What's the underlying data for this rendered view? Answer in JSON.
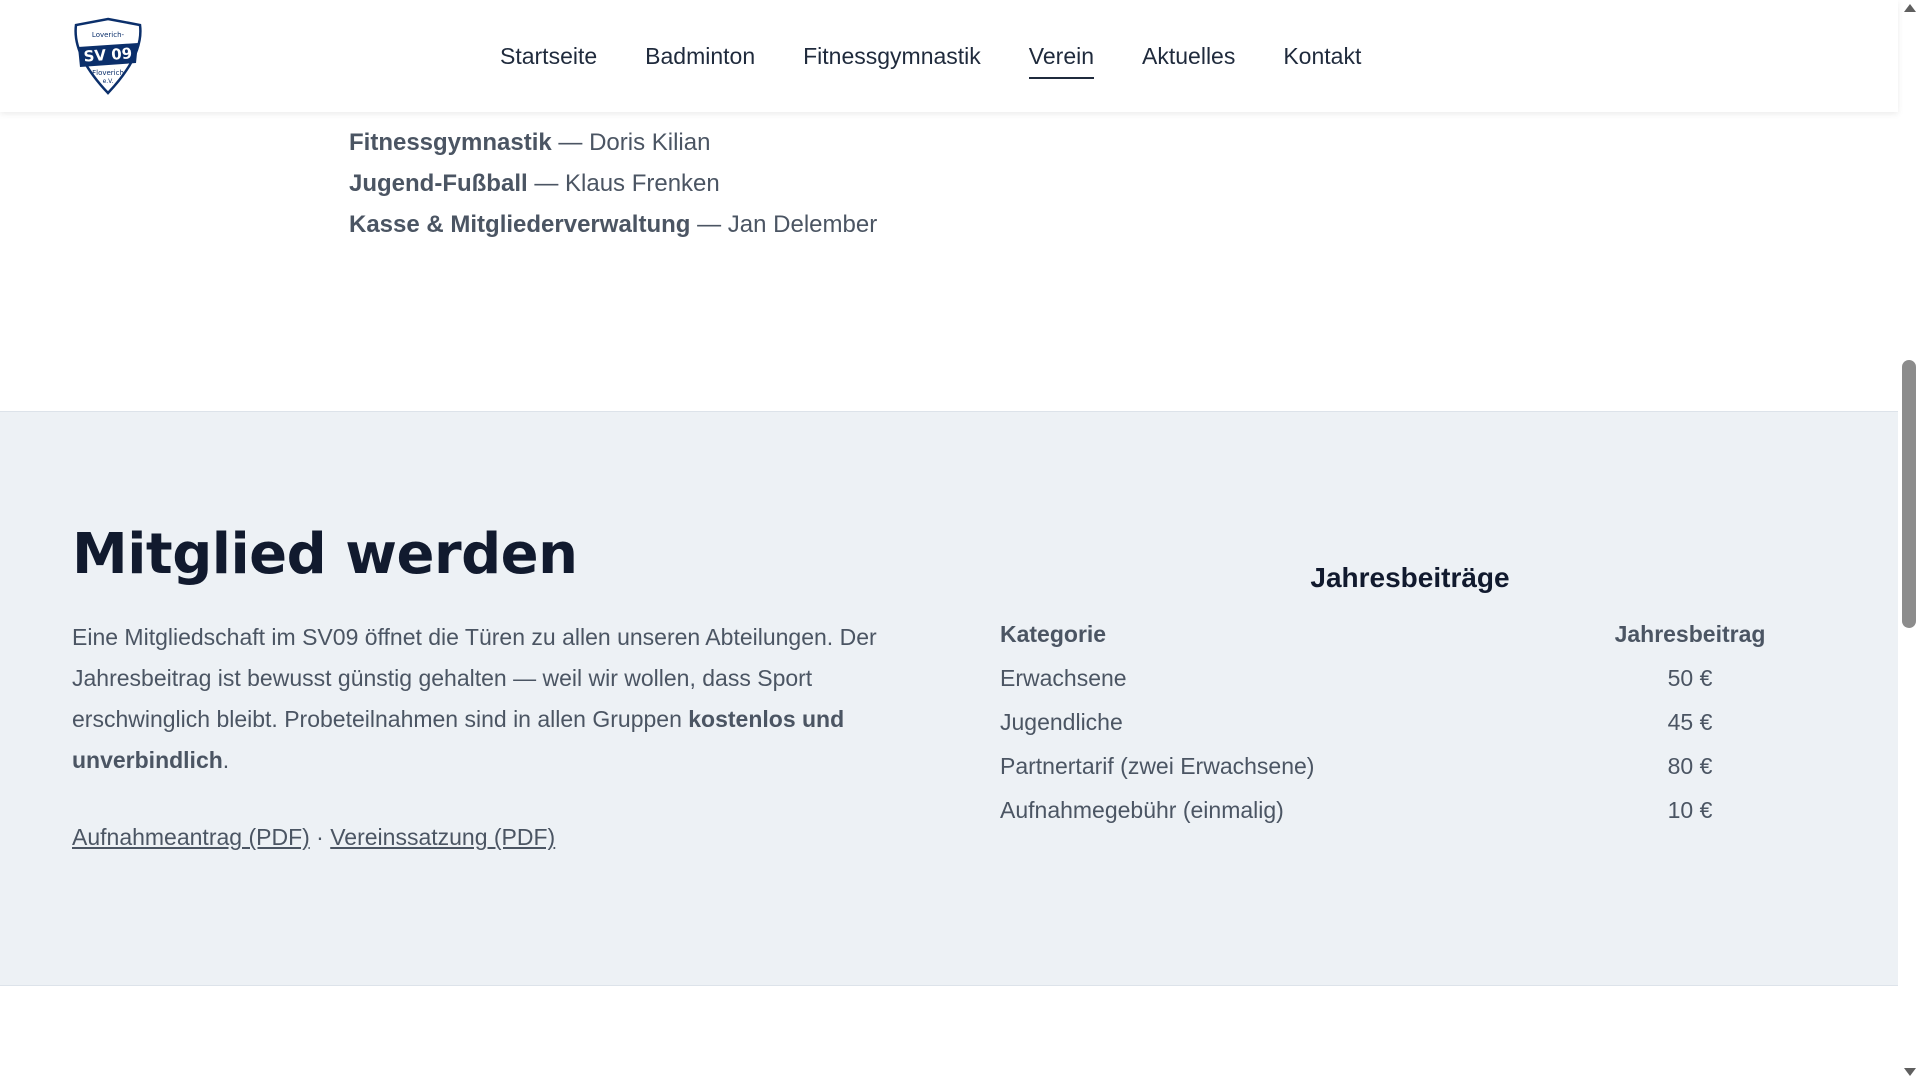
{
  "brand": {
    "logo_text_top": "Loverich-",
    "logo_text_main": "SV 09",
    "logo_text_bottom": "Floverich",
    "logo_text_ev": "e.V.",
    "primary_color": "#0b2f6b",
    "text_color": "#4b5563"
  },
  "nav": {
    "items": [
      {
        "label": "Startseite",
        "active": false
      },
      {
        "label": "Badminton",
        "active": false
      },
      {
        "label": "Fitnessgymnastik",
        "active": false
      },
      {
        "label": "Verein",
        "active": true
      },
      {
        "label": "Aktuelles",
        "active": false
      },
      {
        "label": "Kontakt",
        "active": false
      }
    ]
  },
  "board": {
    "rows": [
      {
        "role": "Fitnessgymnastik",
        "separator": " — ",
        "name": "Doris Kilian"
      },
      {
        "role": "Jugend-Fußball",
        "separator": " — ",
        "name": "Klaus Frenken"
      },
      {
        "role": "Kasse & Mitgliederverwaltung",
        "separator": " — ",
        "name": "Jan Delember"
      }
    ]
  },
  "membership": {
    "title": "Mitglied werden",
    "text_part1": "Eine Mitgliedschaft im SV09 öffnet die Türen zu allen unseren Abteilungen. Der Jahresbeitrag ist bewusst günstig gehalten — weil wir wollen, dass Sport erschwinglich bleibt. Probeteilnahmen sind in allen Gruppen ",
    "text_bold": "kostenlos und unverbindlich",
    "text_part2": ".",
    "link_application": "Aufnahmeantrag (PDF)",
    "link_separator": " · ",
    "link_statute": "Vereinssatzung (PDF)"
  },
  "fees": {
    "title": "Jahresbeiträge",
    "header_category": "Kategorie",
    "header_amount": "Jahresbeitrag",
    "rows": [
      {
        "category": "Erwachsene",
        "amount": "50 €"
      },
      {
        "category": "Jugendliche",
        "amount": "45 €"
      },
      {
        "category": "Partnertarif (zwei Erwachsene)",
        "amount": "80 €"
      },
      {
        "category": "Aufnahmegebühr (einmalig)",
        "amount": "10 €"
      }
    ]
  }
}
